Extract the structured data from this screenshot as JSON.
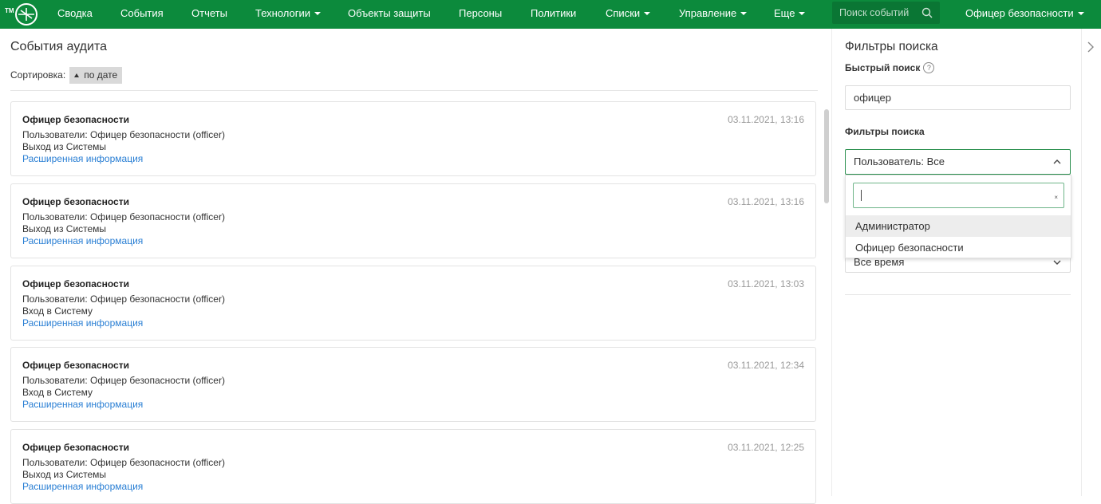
{
  "nav": {
    "logo_text": "TM",
    "items": [
      {
        "label": "Сводка",
        "dropdown": false
      },
      {
        "label": "События",
        "dropdown": false
      },
      {
        "label": "Отчеты",
        "dropdown": false
      },
      {
        "label": "Технологии",
        "dropdown": true
      },
      {
        "label": "Объекты защиты",
        "dropdown": false
      },
      {
        "label": "Персоны",
        "dropdown": false
      },
      {
        "label": "Политики",
        "dropdown": false
      },
      {
        "label": "Списки",
        "dropdown": true
      },
      {
        "label": "Управление",
        "dropdown": true
      },
      {
        "label": "Еще",
        "dropdown": true
      }
    ],
    "search_placeholder": "Поиск событий",
    "user": "Офицер безопасности",
    "accent": "#0c8a3c"
  },
  "main": {
    "title": "События аудита",
    "sort_label": "Сортировка:",
    "sort_value": "по дате",
    "events": [
      {
        "title": "Офицер безопасности",
        "line1": "Пользователи: Офицер безопасности (officer)",
        "line2": "Выход из Системы",
        "link": "Расширенная информация",
        "date": "03.11.2021, 13:16"
      },
      {
        "title": "Офицер безопасности",
        "line1": "Пользователи: Офицер безопасности (officer)",
        "line2": "Выход из Системы",
        "link": "Расширенная информация",
        "date": "03.11.2021, 13:16"
      },
      {
        "title": "Офицер безопасности",
        "line1": "Пользователи: Офицер безопасности (officer)",
        "line2": "Вход в Систему",
        "link": "Расширенная информация",
        "date": "03.11.2021, 13:03"
      },
      {
        "title": "Офицер безопасности",
        "line1": "Пользователи: Офицер безопасности (officer)",
        "line2": "Вход в Систему",
        "link": "Расширенная информация",
        "date": "03.11.2021, 12:34"
      },
      {
        "title": "Офицер безопасности",
        "line1": "Пользователи: Офицер безопасности (officer)",
        "line2": "Выход из Системы",
        "link": "Расширенная информация",
        "date": "03.11.2021, 12:25"
      }
    ]
  },
  "filters": {
    "title": "Фильтры поиска",
    "quick_search_label": "Быстрый поиск",
    "help_glyph": "?",
    "quick_search_value": "офицер",
    "filters_label": "Фильтры поиска",
    "user_select_value": "Пользователь: Все",
    "period_value": "Все время",
    "dropdown": {
      "search_value": "",
      "clear_glyph": "×",
      "options": [
        "Администратор",
        "Офицер безопасности"
      ]
    }
  }
}
